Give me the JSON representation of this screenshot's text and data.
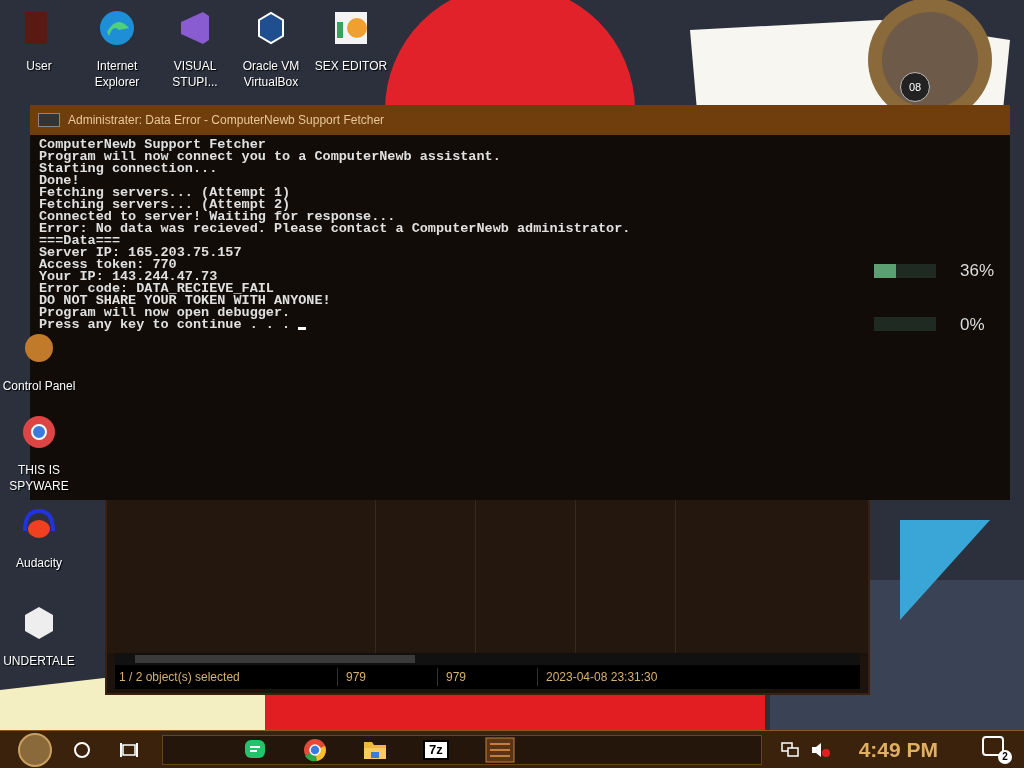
{
  "desktop_icons": [
    {
      "label": "User",
      "kind": "user"
    },
    {
      "label": "Internet Explorer",
      "kind": "browser"
    },
    {
      "label": "VISUAL STUPI...",
      "kind": "ide"
    },
    {
      "label": "Oracle VM VirtualBox",
      "kind": "vm"
    },
    {
      "label": "SEX EDITOR",
      "kind": "hex"
    },
    {
      "label": "Control Panel",
      "kind": "panel"
    },
    {
      "label": "THIS IS SPYWARE",
      "kind": "chrome"
    },
    {
      "label": "Audacity",
      "kind": "audio"
    },
    {
      "label": "UNDERTALE",
      "kind": "unity"
    }
  ],
  "archive_window": {
    "status_bar": [
      "1 / 2 object(s) selected",
      "979",
      "979",
      "2023-04-08 23:31:30"
    ]
  },
  "gadget_meters": [
    {
      "reading": "36%",
      "level": 0.36
    },
    {
      "reading": "0%"
    }
  ],
  "clock": {
    "date": "08"
  },
  "console": {
    "title": "Administrater:  Data Error - ComputerNewb Support Fetcher",
    "lines": [
      "ComputerNewb Support Fetcher",
      "Program will now connect you to a ComputerNewb assistant.",
      "Starting connection...",
      "Done!",
      "Fetching servers... (Attempt 1)",
      "Fetching servers... (Attempt 2)",
      "Connected to server! Waiting for response...",
      "Error: No data was recieved. Please contact a ComputerNewb administrator.",
      "===Data===",
      "Server IP: 165.203.75.157",
      "Access token: 770",
      "Your IP: 143.244.47.73",
      "Error code: DATA_RECIEVE_FAIL",
      "DO NOT SHARE YOUR TOKEN WITH ANYONE!",
      "Program will now open debugger.",
      "Press any key to continue . . . "
    ]
  },
  "taskbar": {
    "apps": [
      {
        "kind": "messages"
      },
      {
        "kind": "chrome"
      },
      {
        "kind": "folder"
      },
      {
        "kind": "archiver",
        "label": "7z"
      },
      {
        "kind": "disk"
      }
    ],
    "time": "4:49 PM",
    "notification_count": "2"
  }
}
